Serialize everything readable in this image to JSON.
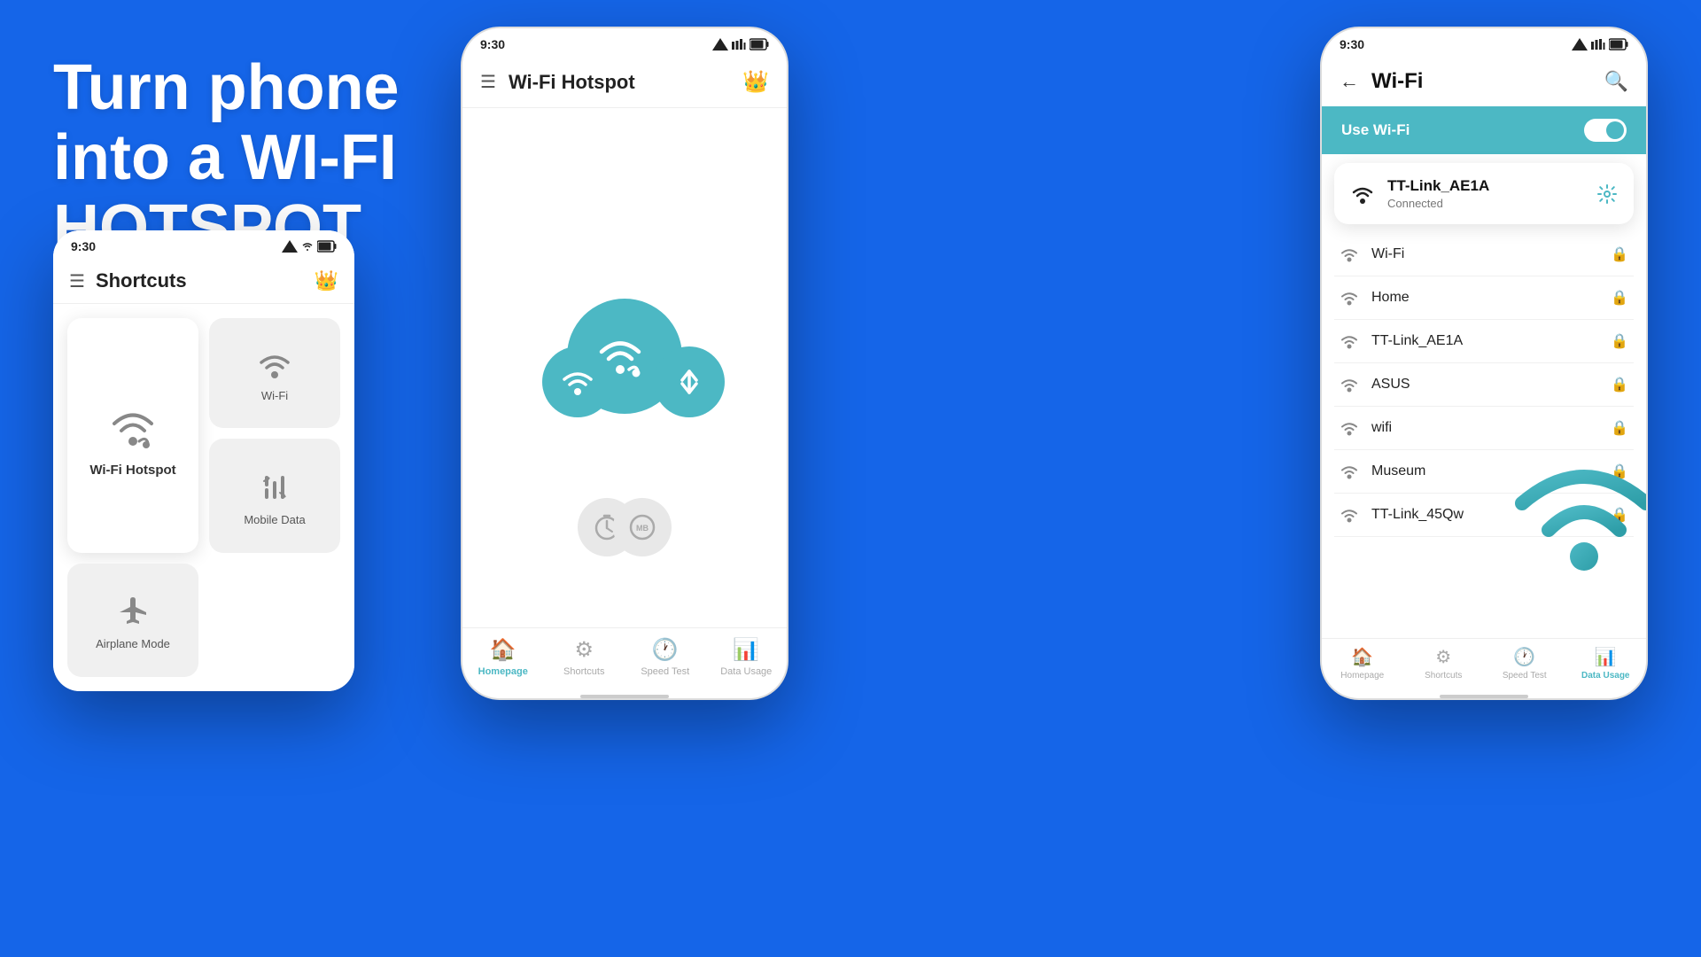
{
  "hero": {
    "line1": "Turn phone",
    "line2": "into a WI-FI",
    "line3": "HOTSPOT"
  },
  "left_phone": {
    "status_time": "9:30",
    "app_title": "Shortcuts",
    "shortcuts": [
      {
        "id": "wifi-hotspot",
        "label": "Wi-Fi Hotspot",
        "large": true
      },
      {
        "id": "wifi",
        "label": "Wi-Fi",
        "large": false
      },
      {
        "id": "mobile-data",
        "label": "Mobile Data",
        "large": false
      },
      {
        "id": "airplane-mode",
        "label": "Airplane Mode",
        "large": false
      }
    ]
  },
  "center_phone": {
    "status_time": "9:30",
    "app_title": "Wi-Fi Hotspot",
    "nav_items": [
      {
        "id": "homepage",
        "label": "Homepage",
        "active": true
      },
      {
        "id": "shortcuts",
        "label": "Shortcuts",
        "active": false
      },
      {
        "id": "speed-test",
        "label": "Speed Test",
        "active": false
      },
      {
        "id": "data-usage",
        "label": "Data Usage",
        "active": false
      }
    ]
  },
  "right_phone": {
    "status_time": "9:30",
    "app_title": "Wi-Fi",
    "use_wifi_label": "Use Wi-Fi",
    "connected_network": {
      "name": "TT-Link_AE1A",
      "status": "Connected"
    },
    "wifi_list": [
      {
        "name": "Wi-Fi",
        "locked": true
      },
      {
        "name": "Home",
        "locked": true
      },
      {
        "name": "TT-Link_AE1A",
        "locked": true
      },
      {
        "name": "ASUS",
        "locked": true
      },
      {
        "name": "wifi",
        "locked": true
      },
      {
        "name": "Museum",
        "locked": true
      },
      {
        "name": "TT-Link_45Qw",
        "locked": true
      }
    ],
    "nav_items": [
      {
        "id": "homepage",
        "label": "Homepage",
        "active": false
      },
      {
        "id": "shortcuts",
        "label": "Shortcuts",
        "active": false
      },
      {
        "id": "speed-test",
        "label": "Speed Test",
        "active": false
      },
      {
        "id": "data-usage",
        "label": "Data Usage",
        "active": true
      }
    ]
  },
  "colors": {
    "teal": "#4CB8C4",
    "blue_bg": "#1565E8",
    "gold": "#f5a623",
    "light_gray": "#f0f0f0",
    "dark_text": "#222222"
  }
}
